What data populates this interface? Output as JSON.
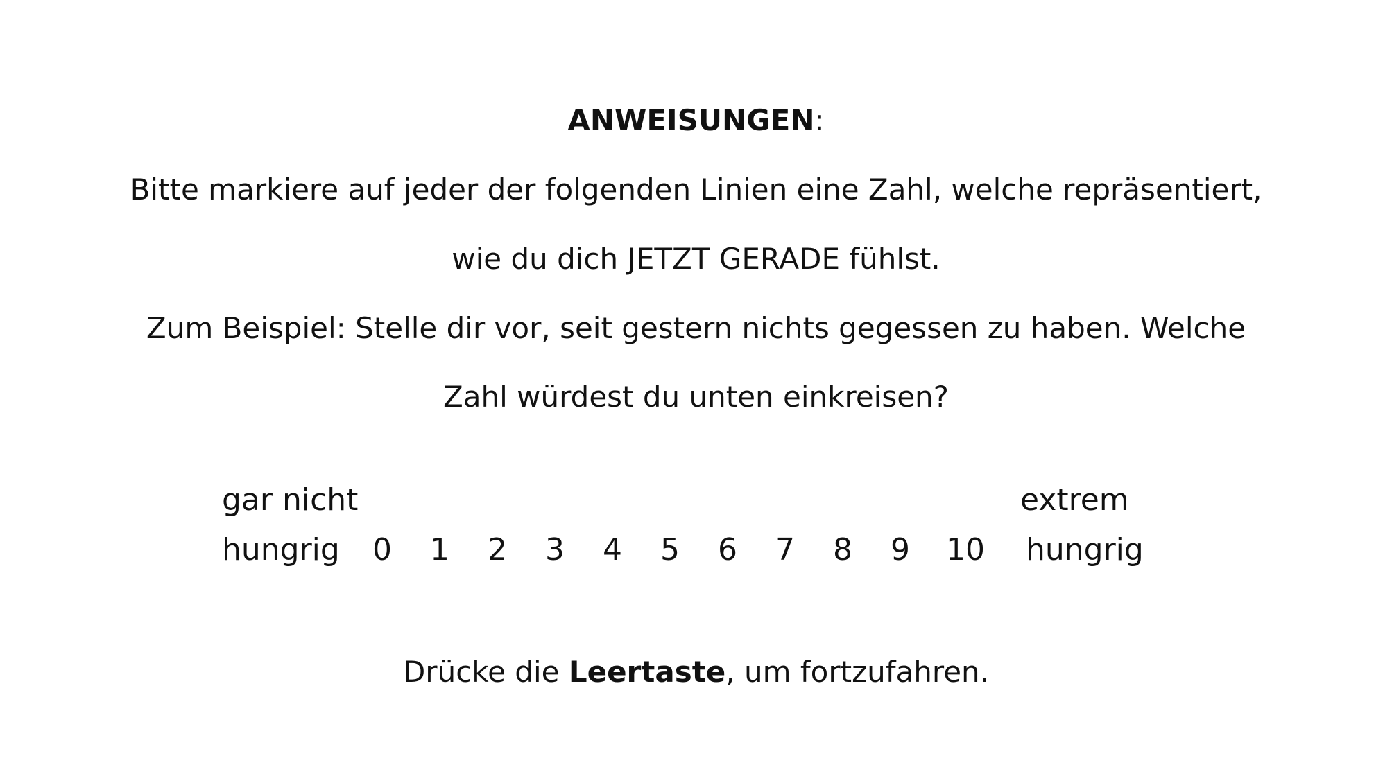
{
  "instructions": {
    "heading_bold": "ANWEISUNGEN",
    "heading_suffix": ":",
    "line1": "Bitte markiere auf jeder der folgenden Linien eine Zahl, welche repräsentiert,",
    "line2": "wie du dich JETZT GERADE fühlst.",
    "line3": "Zum Beispiel: Stelle dir vor, seit gestern nichts gegessen zu haben. Welche",
    "line4": "Zahl würdest du unten einkreisen?"
  },
  "scale": {
    "left_label_line1": "gar nicht",
    "left_label_line2": "hungrig",
    "right_label_line1": "extrem",
    "right_label_line2": "hungrig",
    "numbers": [
      "0",
      "1",
      "2",
      "3",
      "4",
      "5",
      "6",
      "7",
      "8",
      "9",
      "10"
    ]
  },
  "continue_prompt": {
    "prefix": "Drücke die ",
    "key": "Leertaste",
    "suffix": ", um fortzufahren."
  }
}
